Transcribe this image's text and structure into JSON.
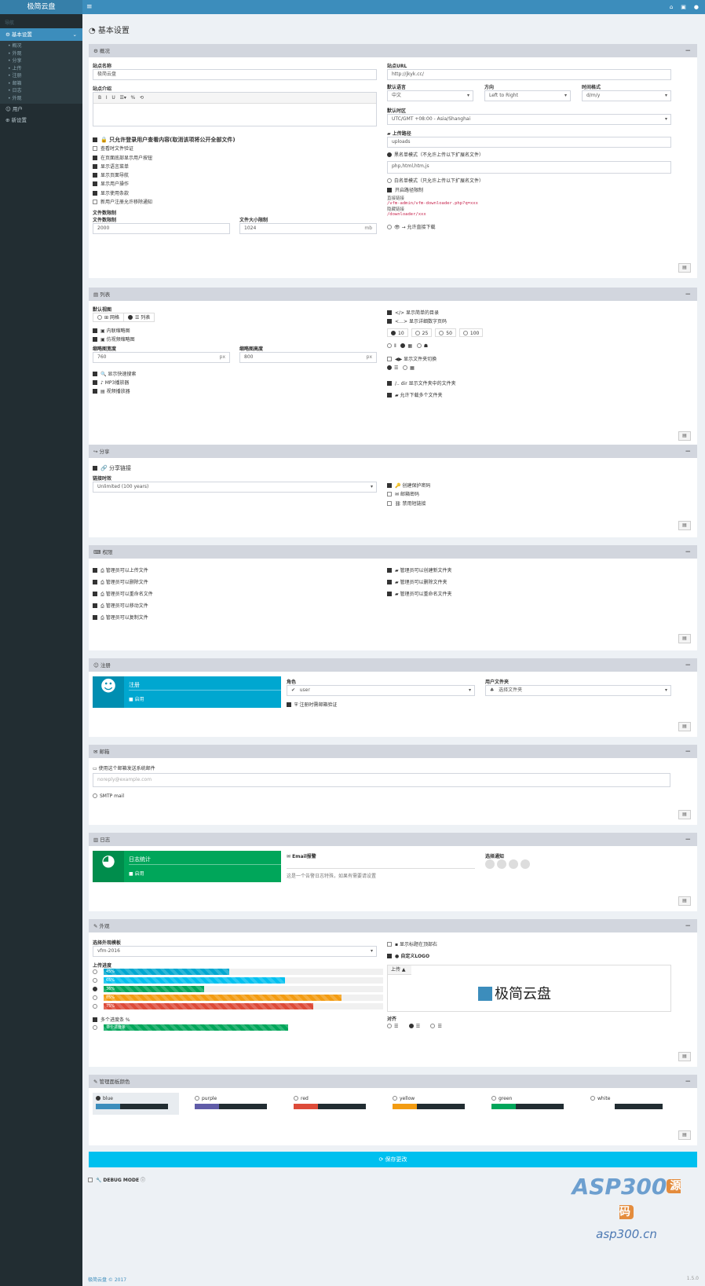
{
  "header": {
    "brand": "极简云盘",
    "menu_icon": "≡",
    "icons": [
      "home-icon",
      "folder-icon",
      "user-icon"
    ]
  },
  "sidebar": {
    "head": "导航",
    "active": "基本设置",
    "subitems": [
      "概况",
      "外观",
      "分享",
      "上传",
      "注册",
      "邮箱",
      "日志",
      "外观"
    ],
    "items": [
      "用户",
      "新设置"
    ]
  },
  "page": {
    "title": "基本设置"
  },
  "general": {
    "title": "概况",
    "site_name_label": "站点名称",
    "site_name": "极简云盘",
    "site_url_label": "站点URL",
    "site_url": "http://jkyk.cc/",
    "desc_label": "站点介绍",
    "lang_label": "默认语言",
    "lang": "中文",
    "dir_label": "方向",
    "dir": "Left to Right",
    "time_label": "时间格式",
    "time": "d/m/y",
    "tz_label": "默认时区",
    "tz": "UTC/GMT +08:00 - Asia/Shanghai",
    "upload_path_label": "上传路径",
    "upload_path": "uploads",
    "files_label": "文件数限制",
    "files": "2000",
    "filesize_label": "文件大小限制",
    "filesize": "1024",
    "unit": "mb",
    "ext_value": "php,html,htm,js",
    "require_login": "只允许登录用户查看内容(取消该项将公开全部文件)",
    "checks": [
      "查看时文件验证",
      "在页面底部显示用户按钮",
      "显示语言菜单",
      "显示页面导航",
      "显示用户操作",
      "显示使用条款",
      "新用户注册允许移除通知"
    ],
    "file_settings": "文件数限制",
    "radio1": "黑名单模式（不允许上传以下扩展名文件）",
    "radio2": "白名单模式（只允许上传以下扩展名文件）",
    "check_path": "开启路径限制",
    "direct_label": "直接链接",
    "direct_code": "/vfm-admin/vfm-downloader.php?q=xxx",
    "hidden_label": "隐藏链接",
    "hidden_code": "/downloader/xxx",
    "direct_toggle": "允许直接下载"
  },
  "list": {
    "title": "列表",
    "default_view": "默认视图",
    "grid": "网格",
    "list": "列表",
    "check_thumbs": "内联缩略图",
    "check_big": "仿视频缩略图",
    "thumb_w_label": "缩略图宽度",
    "thumb_w": "760",
    "thumb_h_label": "缩略图高度",
    "thumb_h": "800",
    "unit": "px",
    "checks_left": [
      "显示快速搜索",
      "MP3播放器",
      "视频播放器"
    ],
    "checks_right": [
      "显示简单的目录",
      "显示详细数字页码"
    ],
    "pages": [
      "10",
      "25",
      "50",
      "100"
    ],
    "sort_label": "显示文件夹切换",
    "show_folders": "显示文件夹中的文件夹",
    "multi": "允许下载多个文件夹"
  },
  "share": {
    "title": "分享",
    "toggle": "分享链接",
    "exp_label": "链接时效",
    "exp": "Unlimited (100 years)",
    "checks": [
      "创建保护密码",
      "邮箱密码",
      "禁用短链接"
    ]
  },
  "perm": {
    "title": "权限",
    "left": [
      "管理员可以上传文件",
      "管理员可以删除文件",
      "管理员可以重命名文件",
      "管理员可以移动文件",
      "管理员可以复制文件"
    ],
    "right": [
      "管理员可以创建新文件夹",
      "管理员可以删除文件夹",
      "管理员可以重命名文件夹"
    ]
  },
  "reg": {
    "title": "注册",
    "tile": "注册",
    "tile_status": "启用",
    "role_label": "角色",
    "role": "user",
    "folder_label": "用户文件夹",
    "folder": "选择文件夹",
    "check": "注册时需邮箱验证"
  },
  "mail": {
    "title": "邮箱",
    "label": "使用这个邮箱发送系统邮件",
    "placeholder": "noreply@example.com",
    "smtp": "SMTP mail"
  },
  "log": {
    "title": "日志",
    "tile": "日志统计",
    "tile_status": "启用",
    "email_label": "Email报警",
    "email_desc": "这是一个告警日志特殊，如果有需要请设置",
    "choose": "选择通知"
  },
  "appearance": {
    "title": "外观",
    "theme_label": "选择外观模板",
    "theme": "vfm-2016",
    "progress_label": "上传进度",
    "bars": [
      {
        "t": "45%",
        "v": 0.45,
        "c": "#00a7d0"
      },
      {
        "t": "65%",
        "v": 0.65,
        "c": "#00c0ef"
      },
      {
        "t": "36%",
        "v": 0.36,
        "c": "#00a65a"
      },
      {
        "t": "85%",
        "v": 0.85,
        "c": "#f39c12"
      },
      {
        "t": "75%",
        "v": 0.75,
        "c": "#dd4b39"
      }
    ],
    "check_multi": "多个进度条 %",
    "single": "单个进度条",
    "check_top": "显示标题在顶部右",
    "logo_check": "自定义LOGO",
    "logo_text": "极简云盘",
    "align_label": "对齐",
    "upload_btn": "上传"
  },
  "colors": {
    "title": "管理面板颜色",
    "swatches": [
      {
        "n": "blue",
        "a": "#3c8dbc",
        "b": "#222d32"
      },
      {
        "n": "purple",
        "a": "#605ca8",
        "b": "#222d32"
      },
      {
        "n": "red",
        "a": "#dd4b39",
        "b": "#222d32"
      },
      {
        "n": "yellow",
        "a": "#f39c12",
        "b": "#222d32"
      },
      {
        "n": "green",
        "a": "#00a65a",
        "b": "#222d32"
      },
      {
        "n": "white",
        "a": "#ffffff",
        "b": "#222d32"
      }
    ]
  },
  "save_label": "保存更改",
  "debug": "DEBUG MODE",
  "footer": {
    "left": "极简云盘 © 2017",
    "right": "1.5.0"
  },
  "watermark": {
    "big": "ASP300",
    "badge": "源码",
    "small": "asp300.cn"
  }
}
